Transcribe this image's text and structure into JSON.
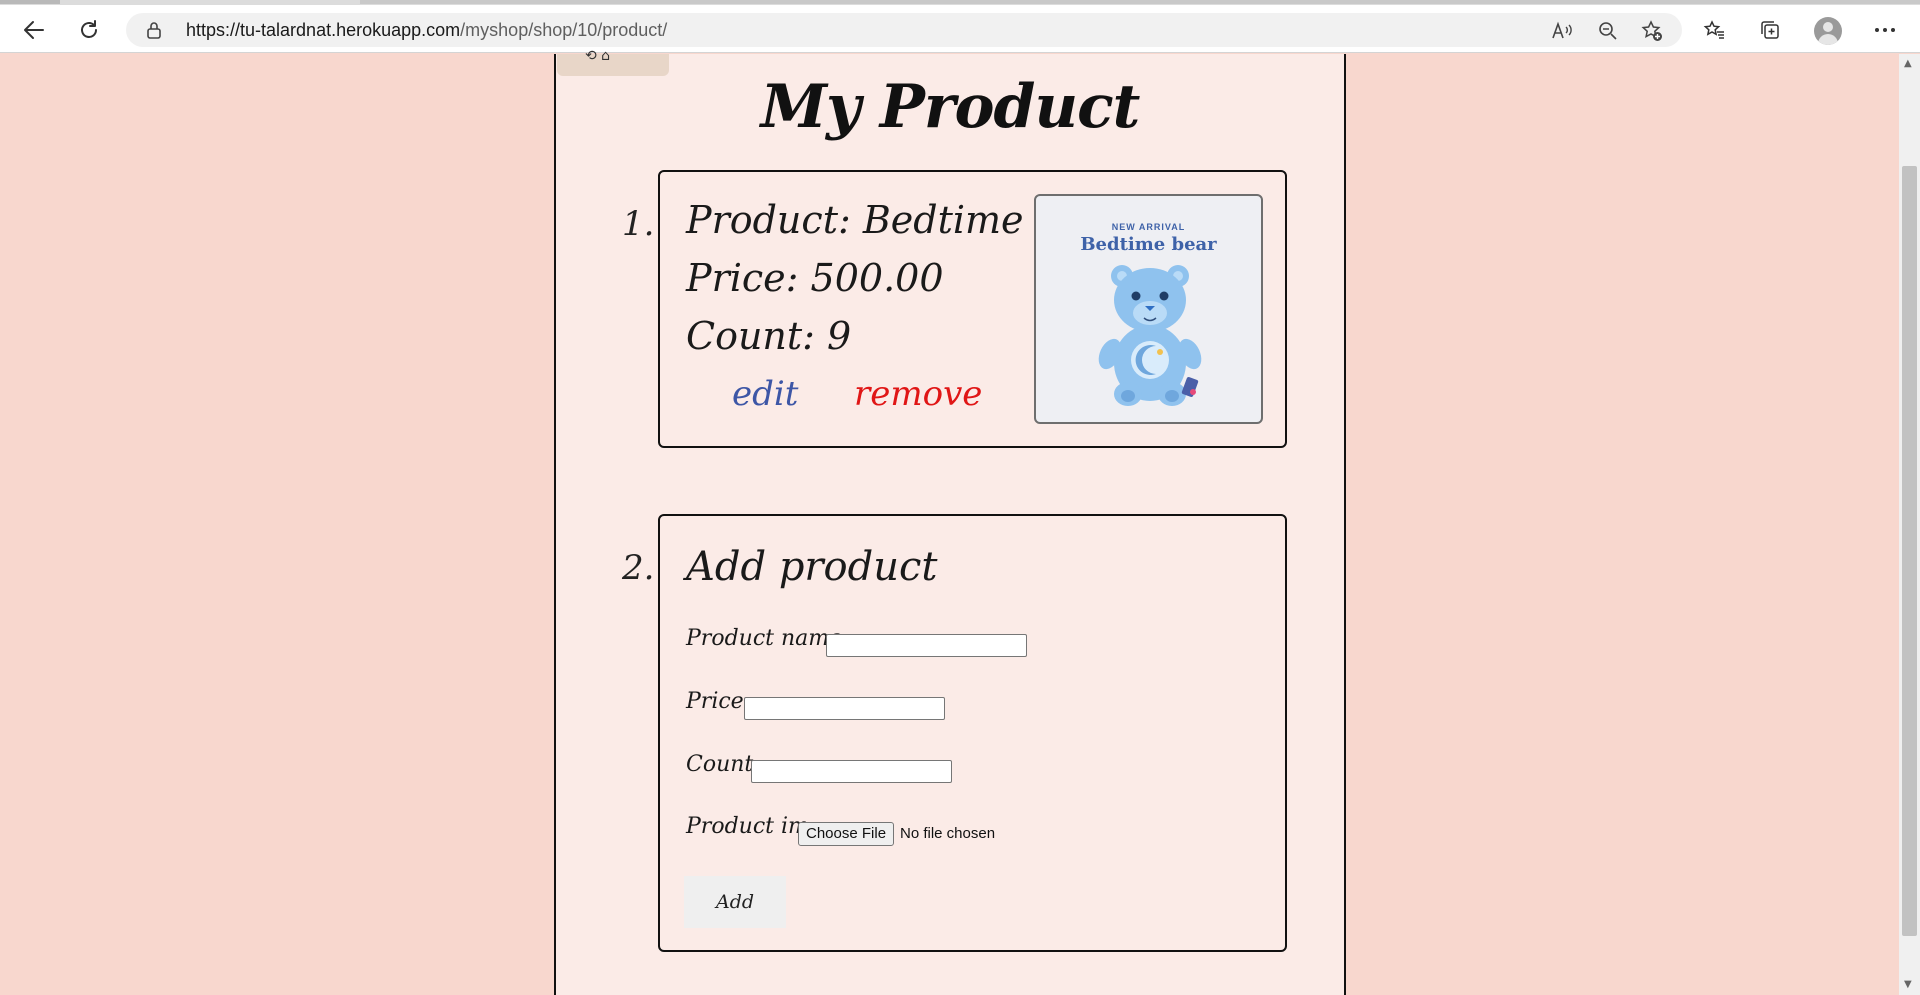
{
  "browser": {
    "url_host": "https://tu-talardnat.herokuapp.com",
    "url_path": "/myshop/shop/10/product/"
  },
  "page": {
    "corner_button_glyph": "⟲ ⌂",
    "title": "My Product"
  },
  "products": [
    {
      "index": "1.",
      "product_line": "Product: Bedtime Bear",
      "price_line": "Price: 500.00",
      "count_line": "Count: 9",
      "edit_label": "edit",
      "remove_label": "remove",
      "image_small_text": "NEW ARRIVAL",
      "image_brand_text": "Bedtime bear"
    }
  ],
  "add_form": {
    "index": "2.",
    "title": "Add product",
    "name_label": "Product name:",
    "name_value": "",
    "price_label": "Price:",
    "price_value": "",
    "count_label": "Count:",
    "count_value": "",
    "image_label": "Product im:",
    "file_button": "Choose File",
    "file_status": "No file chosen",
    "submit_label": "Add"
  },
  "colors": {
    "page_bg": "#f8d7ce",
    "panel_bg": "#fbebe7",
    "edit": "#3d56a6",
    "remove": "#e01616"
  },
  "icons": [
    "back-icon",
    "reload-icon",
    "lock-icon",
    "read-aloud-icon",
    "zoom-out-icon",
    "add-favorite-icon",
    "favorites-icon",
    "collections-icon",
    "profile-avatar",
    "more-icon"
  ]
}
